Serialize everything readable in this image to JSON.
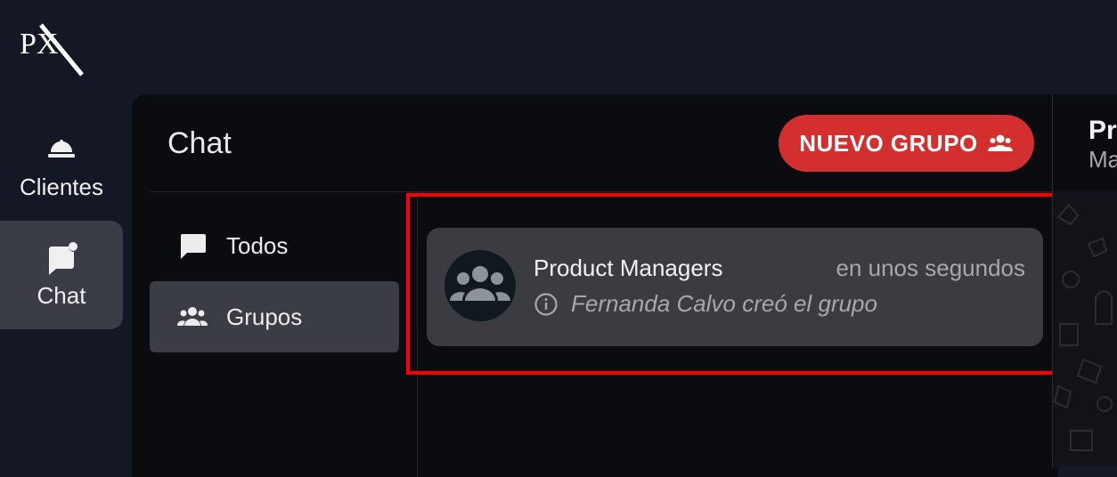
{
  "app": {
    "logo_text": "PX"
  },
  "nav": [
    {
      "label": "Clientes",
      "icon": "bell-icon"
    },
    {
      "label": "Chat",
      "icon": "chat-icon"
    }
  ],
  "chat_panel": {
    "title": "Chat",
    "new_group_button": {
      "label": "NUEVO GRUPO",
      "icon": "group-icon"
    }
  },
  "filters": [
    {
      "label": "Todos",
      "icon": "message-icon"
    },
    {
      "label": "Grupos",
      "icon": "group-icon",
      "selected": true
    }
  ],
  "group": {
    "name": "Product Managers",
    "time": "en unos segundos",
    "last_message": "Fernanda Calvo creó el grupo",
    "avatar_icon": "group-icon",
    "message_icon": "info-icon"
  },
  "right_panel": {
    "title": "Pr",
    "subtitle": "Ma"
  },
  "colors": {
    "background": "#141824",
    "panel": "#0a0c10",
    "accent": "#d32f2f",
    "highlight": "#ff0000"
  }
}
